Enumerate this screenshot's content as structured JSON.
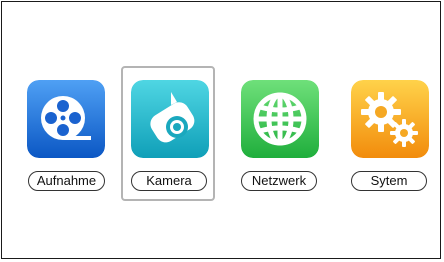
{
  "menu": {
    "items": [
      {
        "label": "Aufnahme",
        "icon": "film-reel-icon",
        "selected": false
      },
      {
        "label": "Kamera",
        "icon": "camera-icon",
        "selected": true
      },
      {
        "label": "Netzwerk",
        "icon": "globe-icon",
        "selected": false
      },
      {
        "label": "Sytem",
        "icon": "gears-icon",
        "selected": false
      }
    ]
  },
  "colors": {
    "aufnahme": "#1f6fd6",
    "kamera": "#1cb5c9",
    "netzwerk": "#2fbf4a",
    "system": "#f6a51a",
    "selection_border": "#b4b4b4"
  }
}
